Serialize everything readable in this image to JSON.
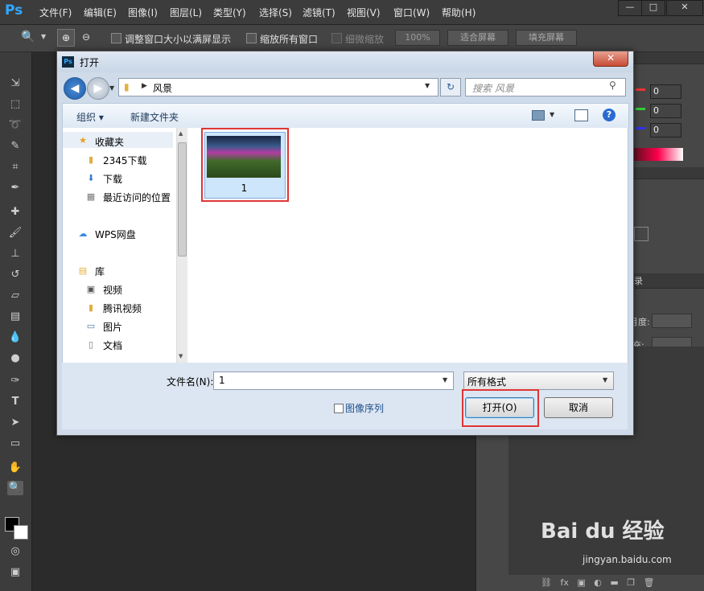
{
  "app": {
    "logo": "Ps",
    "menu": [
      "文件(F)",
      "编辑(E)",
      "图像(I)",
      "图层(L)",
      "类型(Y)",
      "选择(S)",
      "滤镜(T)",
      "视图(V)",
      "窗口(W)",
      "帮助(H)"
    ],
    "window_controls": [
      "—",
      "□",
      "✕"
    ]
  },
  "options_bar": {
    "resize_windows": "调整窗口大小以满屏显示",
    "zoom_all": "缩放所有窗口",
    "scrubby_zoom": "细微缩放",
    "zoom_percent": "100%",
    "fit_screen": "适合屏幕",
    "fill_screen": "填充屏幕"
  },
  "right_panel": {
    "color_r": "0",
    "color_g": "0",
    "color_b": "0",
    "layers_label_fragment": "录",
    "opacity_fragment": "月度:",
    "fill_fragment": "充:"
  },
  "dialog": {
    "title": "打开",
    "close": "✕",
    "address": "风景",
    "search_placeholder": "搜索 风景",
    "organize": "组织 ▾",
    "new_folder": "新建文件夹",
    "nav": {
      "favorites": "收藏夹",
      "items": [
        "2345下载",
        "下载",
        "最近访问的位置"
      ],
      "cloud": "WPS网盘",
      "library": "库",
      "library_items": [
        "视频",
        "腾讯视频",
        "图片",
        "文档"
      ]
    },
    "file": {
      "name": "1"
    },
    "filename_label": "文件名(N):",
    "filename_value": "1",
    "filetype": "所有格式",
    "image_sequence": "图像序列",
    "open_button": "打开(O)",
    "cancel_button": "取消"
  },
  "watermark": {
    "brand": "Bai du 经验",
    "url": "jingyan.baidu.com"
  }
}
